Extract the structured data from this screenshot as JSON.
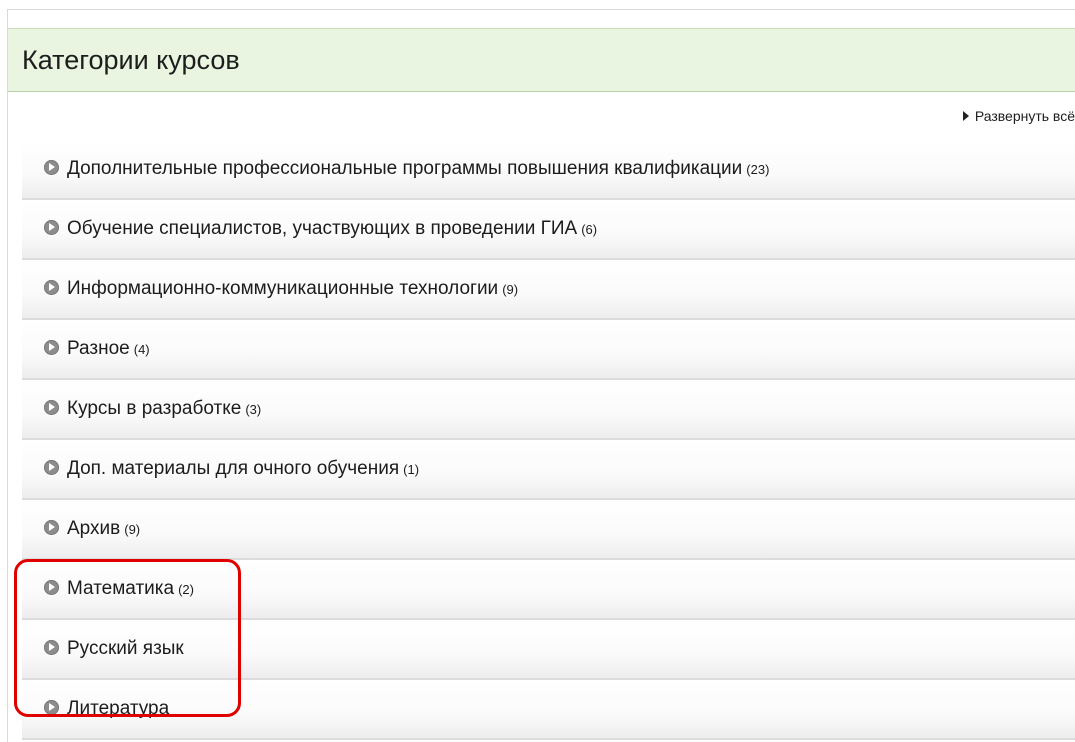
{
  "header": {
    "title": "Категории курсов"
  },
  "toolbar": {
    "expand_all_label": "Развернуть всё"
  },
  "categories": [
    {
      "name": "Дополнительные профессиональные программы повышения квалификации",
      "count": "(23)"
    },
    {
      "name": "Обучение специалистов, участвующих в проведении ГИА",
      "count": "(6)"
    },
    {
      "name": "Информационно-коммуникационные технологии",
      "count": "(9)"
    },
    {
      "name": "Разное",
      "count": "(4)"
    },
    {
      "name": "Курсы в разработке",
      "count": "(3)"
    },
    {
      "name": "Доп. материалы для очного обучения",
      "count": "(1)"
    },
    {
      "name": "Архив",
      "count": "(9)"
    },
    {
      "name": "Математика",
      "count": "(2)"
    },
    {
      "name": "Русский язык",
      "count": ""
    },
    {
      "name": "Литература",
      "count": ""
    }
  ],
  "icons": {
    "category_expand": "chevron-right-circle-icon",
    "expand_all": "triangle-right-icon"
  },
  "colors": {
    "header_background": "#e9f5e0",
    "highlight_border": "#e00000",
    "icon_gray": "#8c8c8c"
  }
}
